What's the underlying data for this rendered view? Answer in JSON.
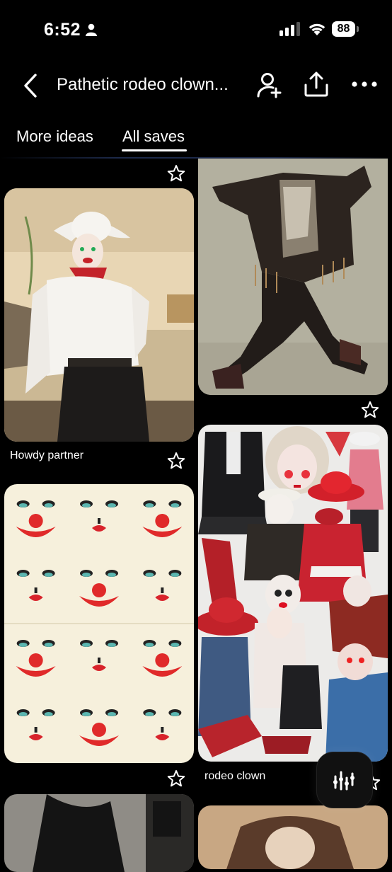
{
  "status_bar": {
    "time": "6:52",
    "battery": "88"
  },
  "header": {
    "title": "Pathetic rodeo clown..."
  },
  "tabs": [
    {
      "label": "More ideas"
    },
    {
      "label": "All saves"
    }
  ],
  "pins": [
    {
      "caption": "Howdy partner"
    },
    {
      "caption": "rodeo clown"
    }
  ],
  "icons": {
    "back": "chevron-left-icon",
    "invite": "add-person-icon",
    "share": "share-upload-icon",
    "more": "ellipsis-icon",
    "save": "star-icon",
    "fab": "sliders-icon"
  }
}
